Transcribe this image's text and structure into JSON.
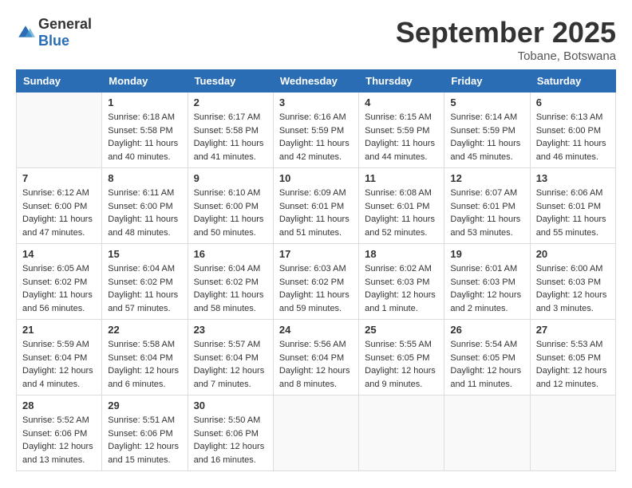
{
  "logo": {
    "general": "General",
    "blue": "Blue"
  },
  "title": "September 2025",
  "location": "Tobane, Botswana",
  "days_of_week": [
    "Sunday",
    "Monday",
    "Tuesday",
    "Wednesday",
    "Thursday",
    "Friday",
    "Saturday"
  ],
  "weeks": [
    [
      {
        "day": "",
        "sunrise": "",
        "sunset": "",
        "daylight": ""
      },
      {
        "day": "1",
        "sunrise": "Sunrise: 6:18 AM",
        "sunset": "Sunset: 5:58 PM",
        "daylight": "Daylight: 11 hours and 40 minutes."
      },
      {
        "day": "2",
        "sunrise": "Sunrise: 6:17 AM",
        "sunset": "Sunset: 5:58 PM",
        "daylight": "Daylight: 11 hours and 41 minutes."
      },
      {
        "day": "3",
        "sunrise": "Sunrise: 6:16 AM",
        "sunset": "Sunset: 5:59 PM",
        "daylight": "Daylight: 11 hours and 42 minutes."
      },
      {
        "day": "4",
        "sunrise": "Sunrise: 6:15 AM",
        "sunset": "Sunset: 5:59 PM",
        "daylight": "Daylight: 11 hours and 44 minutes."
      },
      {
        "day": "5",
        "sunrise": "Sunrise: 6:14 AM",
        "sunset": "Sunset: 5:59 PM",
        "daylight": "Daylight: 11 hours and 45 minutes."
      },
      {
        "day": "6",
        "sunrise": "Sunrise: 6:13 AM",
        "sunset": "Sunset: 6:00 PM",
        "daylight": "Daylight: 11 hours and 46 minutes."
      }
    ],
    [
      {
        "day": "7",
        "sunrise": "Sunrise: 6:12 AM",
        "sunset": "Sunset: 6:00 PM",
        "daylight": "Daylight: 11 hours and 47 minutes."
      },
      {
        "day": "8",
        "sunrise": "Sunrise: 6:11 AM",
        "sunset": "Sunset: 6:00 PM",
        "daylight": "Daylight: 11 hours and 48 minutes."
      },
      {
        "day": "9",
        "sunrise": "Sunrise: 6:10 AM",
        "sunset": "Sunset: 6:00 PM",
        "daylight": "Daylight: 11 hours and 50 minutes."
      },
      {
        "day": "10",
        "sunrise": "Sunrise: 6:09 AM",
        "sunset": "Sunset: 6:01 PM",
        "daylight": "Daylight: 11 hours and 51 minutes."
      },
      {
        "day": "11",
        "sunrise": "Sunrise: 6:08 AM",
        "sunset": "Sunset: 6:01 PM",
        "daylight": "Daylight: 11 hours and 52 minutes."
      },
      {
        "day": "12",
        "sunrise": "Sunrise: 6:07 AM",
        "sunset": "Sunset: 6:01 PM",
        "daylight": "Daylight: 11 hours and 53 minutes."
      },
      {
        "day": "13",
        "sunrise": "Sunrise: 6:06 AM",
        "sunset": "Sunset: 6:01 PM",
        "daylight": "Daylight: 11 hours and 55 minutes."
      }
    ],
    [
      {
        "day": "14",
        "sunrise": "Sunrise: 6:05 AM",
        "sunset": "Sunset: 6:02 PM",
        "daylight": "Daylight: 11 hours and 56 minutes."
      },
      {
        "day": "15",
        "sunrise": "Sunrise: 6:04 AM",
        "sunset": "Sunset: 6:02 PM",
        "daylight": "Daylight: 11 hours and 57 minutes."
      },
      {
        "day": "16",
        "sunrise": "Sunrise: 6:04 AM",
        "sunset": "Sunset: 6:02 PM",
        "daylight": "Daylight: 11 hours and 58 minutes."
      },
      {
        "day": "17",
        "sunrise": "Sunrise: 6:03 AM",
        "sunset": "Sunset: 6:02 PM",
        "daylight": "Daylight: 11 hours and 59 minutes."
      },
      {
        "day": "18",
        "sunrise": "Sunrise: 6:02 AM",
        "sunset": "Sunset: 6:03 PM",
        "daylight": "Daylight: 12 hours and 1 minute."
      },
      {
        "day": "19",
        "sunrise": "Sunrise: 6:01 AM",
        "sunset": "Sunset: 6:03 PM",
        "daylight": "Daylight: 12 hours and 2 minutes."
      },
      {
        "day": "20",
        "sunrise": "Sunrise: 6:00 AM",
        "sunset": "Sunset: 6:03 PM",
        "daylight": "Daylight: 12 hours and 3 minutes."
      }
    ],
    [
      {
        "day": "21",
        "sunrise": "Sunrise: 5:59 AM",
        "sunset": "Sunset: 6:04 PM",
        "daylight": "Daylight: 12 hours and 4 minutes."
      },
      {
        "day": "22",
        "sunrise": "Sunrise: 5:58 AM",
        "sunset": "Sunset: 6:04 PM",
        "daylight": "Daylight: 12 hours and 6 minutes."
      },
      {
        "day": "23",
        "sunrise": "Sunrise: 5:57 AM",
        "sunset": "Sunset: 6:04 PM",
        "daylight": "Daylight: 12 hours and 7 minutes."
      },
      {
        "day": "24",
        "sunrise": "Sunrise: 5:56 AM",
        "sunset": "Sunset: 6:04 PM",
        "daylight": "Daylight: 12 hours and 8 minutes."
      },
      {
        "day": "25",
        "sunrise": "Sunrise: 5:55 AM",
        "sunset": "Sunset: 6:05 PM",
        "daylight": "Daylight: 12 hours and 9 minutes."
      },
      {
        "day": "26",
        "sunrise": "Sunrise: 5:54 AM",
        "sunset": "Sunset: 6:05 PM",
        "daylight": "Daylight: 12 hours and 11 minutes."
      },
      {
        "day": "27",
        "sunrise": "Sunrise: 5:53 AM",
        "sunset": "Sunset: 6:05 PM",
        "daylight": "Daylight: 12 hours and 12 minutes."
      }
    ],
    [
      {
        "day": "28",
        "sunrise": "Sunrise: 5:52 AM",
        "sunset": "Sunset: 6:06 PM",
        "daylight": "Daylight: 12 hours and 13 minutes."
      },
      {
        "day": "29",
        "sunrise": "Sunrise: 5:51 AM",
        "sunset": "Sunset: 6:06 PM",
        "daylight": "Daylight: 12 hours and 15 minutes."
      },
      {
        "day": "30",
        "sunrise": "Sunrise: 5:50 AM",
        "sunset": "Sunset: 6:06 PM",
        "daylight": "Daylight: 12 hours and 16 minutes."
      },
      {
        "day": "",
        "sunrise": "",
        "sunset": "",
        "daylight": ""
      },
      {
        "day": "",
        "sunrise": "",
        "sunset": "",
        "daylight": ""
      },
      {
        "day": "",
        "sunrise": "",
        "sunset": "",
        "daylight": ""
      },
      {
        "day": "",
        "sunrise": "",
        "sunset": "",
        "daylight": ""
      }
    ]
  ]
}
